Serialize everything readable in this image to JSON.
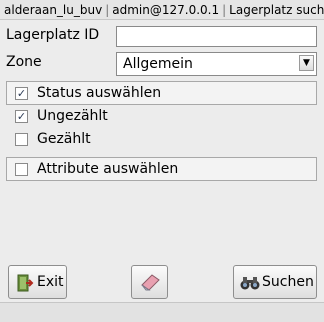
{
  "window": {
    "title_parts": [
      "alderaan_lu_buv",
      "admin@127.0.0.1",
      "Lagerplatz suchen"
    ],
    "separator": "|"
  },
  "form": {
    "lagerplatz_label": "Lagerplatz ID",
    "lagerplatz_value": "",
    "zone_label": "Zone",
    "zone_value": "Allgemein"
  },
  "status_group": {
    "label": "Status auswählen",
    "checked": true,
    "options": [
      {
        "label": "Ungezählt",
        "checked": true
      },
      {
        "label": "Gezählt",
        "checked": false
      }
    ]
  },
  "attribute_group": {
    "label": "Attribute auswählen",
    "checked": false
  },
  "buttons": {
    "exit_label": "Exit",
    "clear_icon": "eraser-icon",
    "search_label": "Suchen"
  }
}
